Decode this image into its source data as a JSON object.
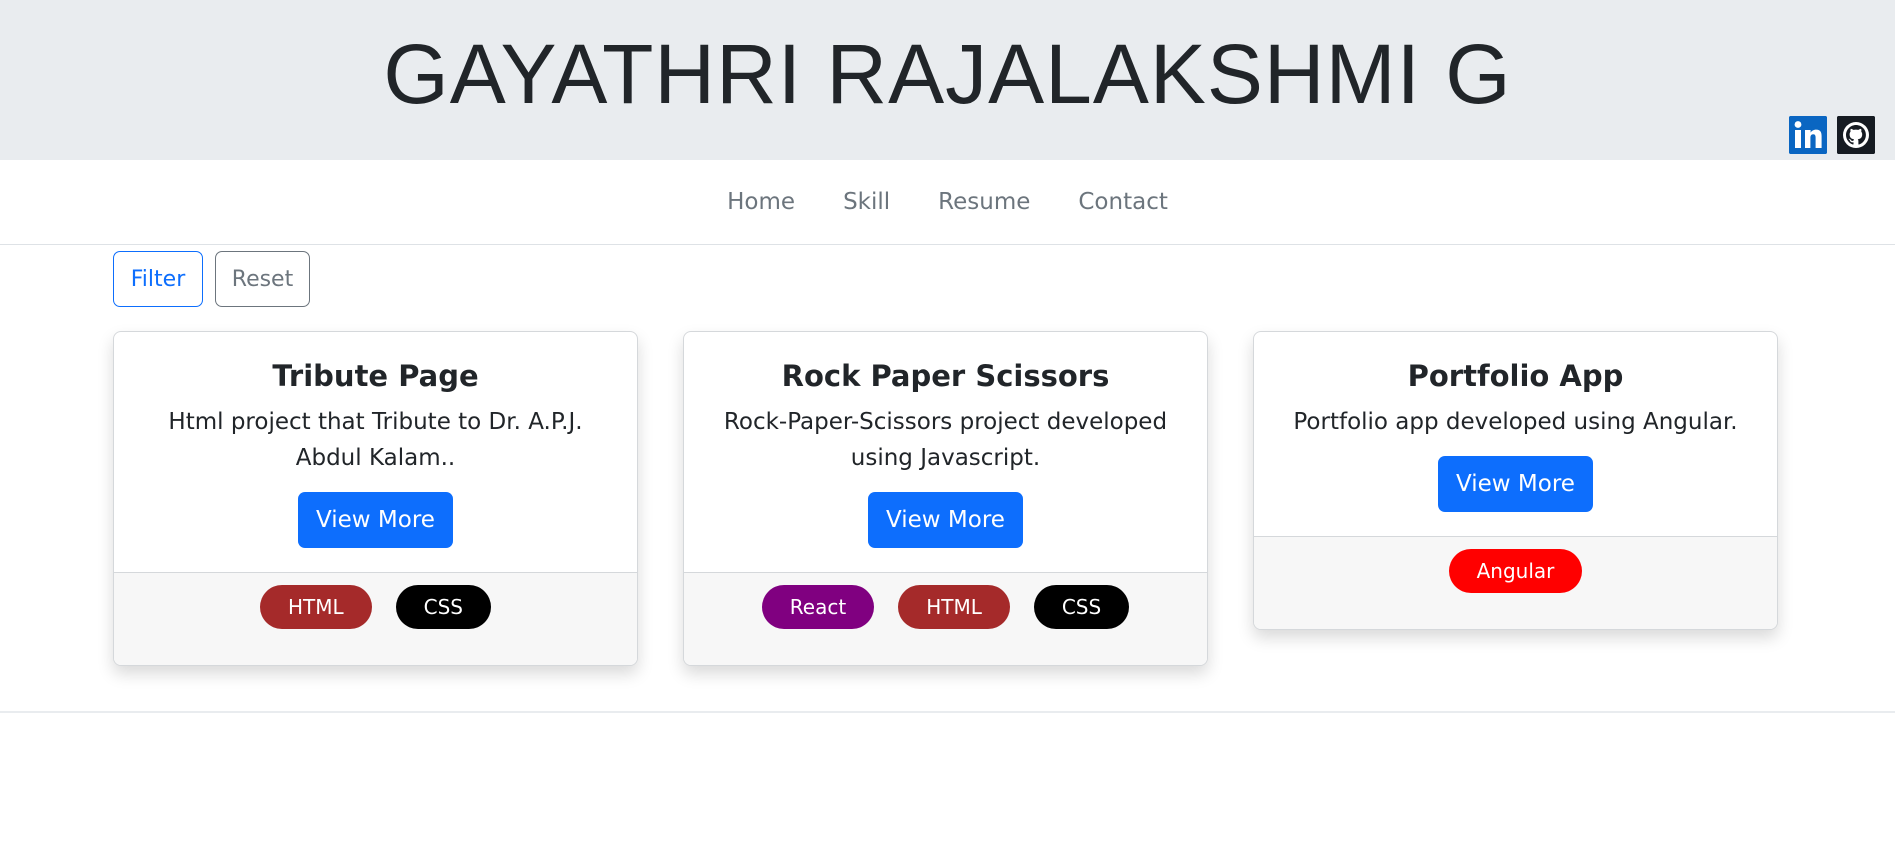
{
  "header": {
    "title": "GAYATHRI RAJALAKSHMI G",
    "social": [
      {
        "icon": "linkedin-icon",
        "label": "in"
      },
      {
        "icon": "github-icon"
      }
    ]
  },
  "nav": {
    "items": [
      "Home",
      "Skill",
      "Resume",
      "Contact"
    ]
  },
  "filters": {
    "filter_label": "Filter",
    "reset_label": "Reset"
  },
  "cards": [
    {
      "title": "Tribute Page",
      "text": "Html project that Tribute to Dr. A.P.J. Abdul Kalam..",
      "button": "View More",
      "tags": [
        {
          "label": "HTML",
          "color": "#a52a2a"
        },
        {
          "label": "CSS",
          "color": "#000000"
        }
      ]
    },
    {
      "title": "Rock Paper Scissors",
      "text": "Rock-Paper-Scissors project developed using Javascript.",
      "button": "View More",
      "tags": [
        {
          "label": "React",
          "color": "#800080"
        },
        {
          "label": "HTML",
          "color": "#a52a2a"
        },
        {
          "label": "CSS",
          "color": "#000000"
        }
      ]
    },
    {
      "title": "Portfolio App",
      "text": "Portfolio app developed using Angular.",
      "button": "View More",
      "tags": [
        {
          "label": "Angular",
          "color": "#ff0000"
        }
      ]
    }
  ],
  "colors": {
    "header_bg": "#e9ecef",
    "primary": "#0d6efd",
    "secondary": "#6c757d"
  }
}
